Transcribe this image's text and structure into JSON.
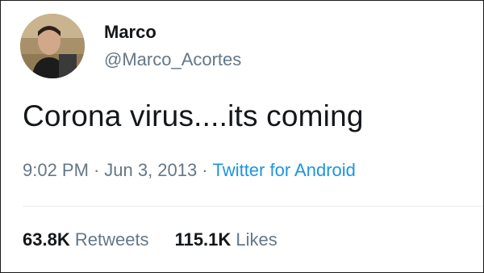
{
  "user": {
    "display_name": "Marco",
    "handle": "@Marco_Acortes"
  },
  "tweet": {
    "text": "Corona virus....its coming",
    "time": "9:02 PM",
    "date": "Jun 3, 2013",
    "separator": "·",
    "source": "Twitter for Android"
  },
  "stats": {
    "retweets_count": "63.8K",
    "retweets_label": "Retweets",
    "likes_count": "115.1K",
    "likes_label": "Likes"
  },
  "colors": {
    "primary_text": "#14171a",
    "secondary_text": "#657786",
    "link": "#1b95e0",
    "divider": "#e6ecf0"
  }
}
